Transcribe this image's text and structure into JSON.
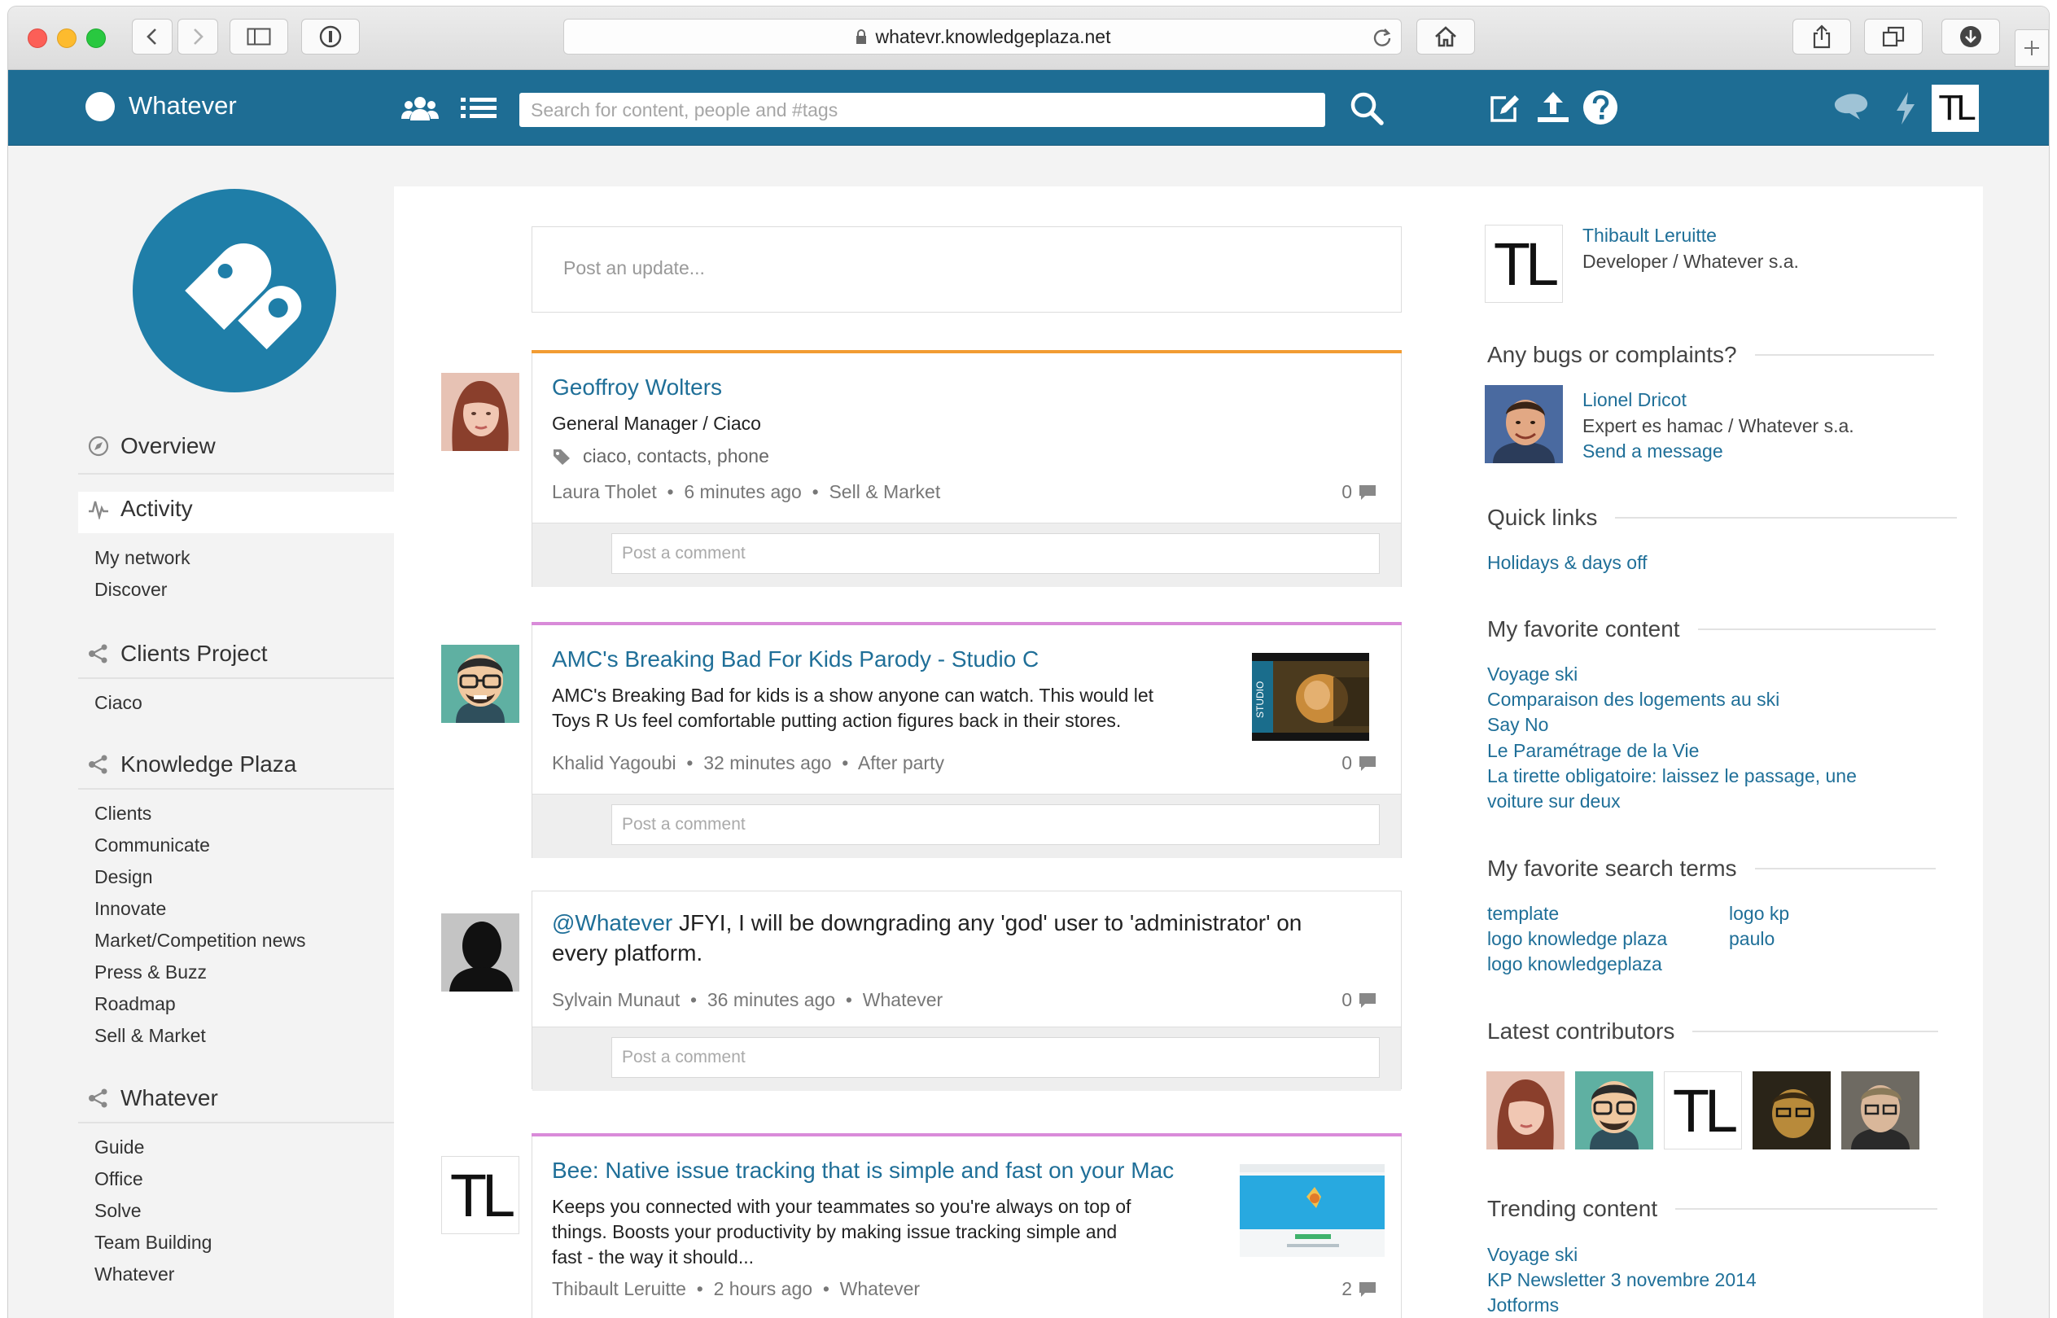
{
  "browser": {
    "url": "whatevr.knowledgeplaza.net"
  },
  "app": {
    "brand": "Whatever",
    "search_placeholder": "Search for content, people and #tags",
    "user_initials": "TL"
  },
  "sidebar": {
    "overview": "Overview",
    "activity": "Activity",
    "activity_items": [
      "My network",
      "Discover"
    ],
    "clients_project": "Clients Project",
    "clients_items": [
      "Ciaco"
    ],
    "knowledge_plaza": "Knowledge Plaza",
    "kp_items": [
      "Clients",
      "Communicate",
      "Design",
      "Innovate",
      "Market/Competition news",
      "Press & Buzz",
      "Roadmap",
      "Sell & Market"
    ],
    "whatever": "Whatever",
    "whatever_items": [
      "Guide",
      "Office",
      "Solve",
      "Team Building",
      "Whatever"
    ]
  },
  "feed": {
    "post_placeholder": "Post an update...",
    "comment_placeholder": "Post a comment",
    "posts": [
      {
        "title": "Geoffroy Wolters",
        "subtitle": "General Manager / Ciaco",
        "tags": "ciaco, contacts, phone",
        "author": "Laura Tholet",
        "time": "6 minutes ago",
        "space": "Sell & Market",
        "comments": "0",
        "accent": "#f29c33"
      },
      {
        "title": "AMC's Breaking Bad For Kids Parody - Studio C",
        "body_1": "AMC's Breaking Bad for kids is a show anyone can watch. This would let",
        "body_2": "Toys R Us feel comfortable putting action figures back in their stores.",
        "author": "Khalid Yagoubi",
        "time": "32 minutes ago",
        "space": "After party",
        "comments": "0",
        "thumb_label": "STUDIO",
        "accent": "#d98bd9"
      },
      {
        "mention": "@Whatever",
        "body_1": " JFYI, I will be downgrading any 'god' user to 'administrator' on",
        "body_2": "every platform.",
        "author": "Sylvain Munaut",
        "time": "36 minutes ago",
        "space": "Whatever",
        "comments": "0",
        "accent": "#dcdcdc"
      },
      {
        "title": "Bee: Native issue tracking that is simple and fast on your Mac",
        "body_1": "Keeps you connected with your teammates so you're always on top of",
        "body_2": "things. Boosts your productivity by making issue tracking simple and",
        "body_3": "fast - the way it should...",
        "author": "Thibault Leruitte",
        "time": "2 hours ago",
        "space": "Whatever",
        "comments": "2",
        "avatar_initials": "TL",
        "accent": "#d98bd9"
      }
    ]
  },
  "right": {
    "profile_name": "Thibault Leruitte",
    "profile_role": "Developer / Whatever s.a.",
    "bugs_heading": "Any bugs or complaints?",
    "contact_name": "Lionel Dricot",
    "contact_role": "Expert es hamac / Whatever s.a.",
    "contact_action": "Send a message",
    "quick_links_heading": "Quick links",
    "quick_links": [
      "Holidays & days off"
    ],
    "favorite_content_heading": "My favorite content",
    "favorite_content": [
      "Voyage ski",
      "Comparaison des logements au ski",
      "Say No",
      "Le Paramétrage de la Vie",
      "La tirette obligatoire: laissez le passage, une",
      "voiture sur deux"
    ],
    "favorite_search_heading": "My favorite search terms",
    "search_terms_left": [
      "template",
      "logo knowledge plaza",
      "logo knowledgeplaza"
    ],
    "search_terms_right": [
      "logo kp",
      "paulo"
    ],
    "contributors_heading": "Latest contributors",
    "contributor_initials": "TL",
    "trending_heading": "Trending content",
    "trending": [
      "Voyage ski",
      "KP Newsletter 3 novembre 2014",
      "Jotforms"
    ]
  }
}
